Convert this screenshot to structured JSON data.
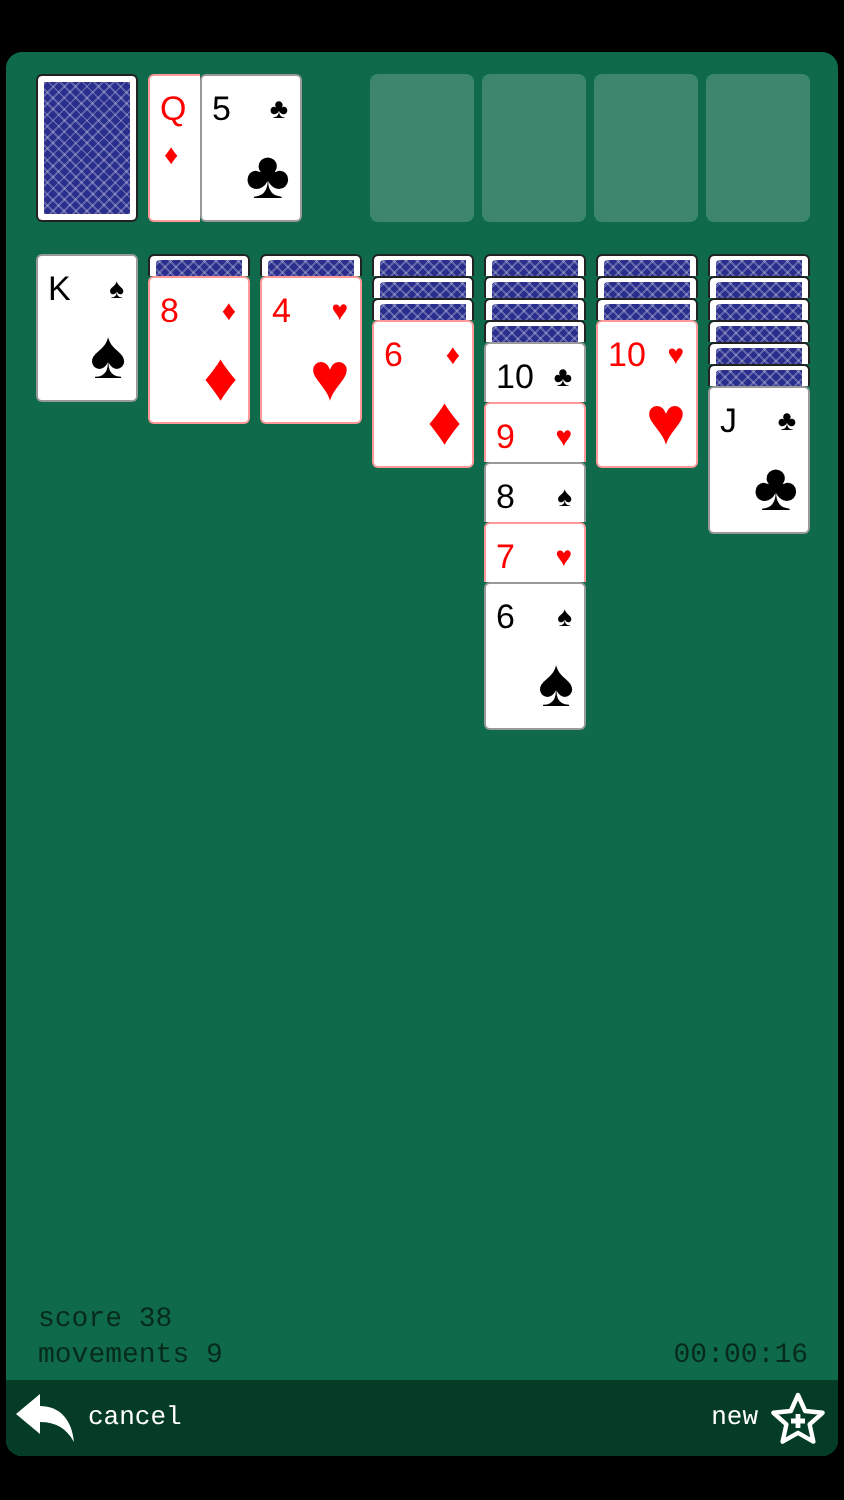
{
  "stock": {
    "face_down": true
  },
  "waste": [
    {
      "rank": "Q",
      "suit": "♦",
      "color": "#ff0000"
    },
    {
      "rank": "5",
      "suit": "♣",
      "pip": "♣",
      "color": "#000000"
    }
  ],
  "foundations": [
    {
      "kind": "empty"
    },
    {
      "kind": "empty"
    },
    {
      "kind": "empty"
    },
    {
      "kind": "empty"
    }
  ],
  "tableau": [
    {
      "cards": [
        {
          "kind": "face",
          "rank": "K",
          "suit": "♠",
          "pip": "♠",
          "color": "#000000"
        }
      ]
    },
    {
      "cards": [
        {
          "kind": "back"
        },
        {
          "kind": "face",
          "rank": "8",
          "suit": "♦",
          "pip": "♦",
          "color": "#ff0000"
        }
      ]
    },
    {
      "cards": [
        {
          "kind": "back"
        },
        {
          "kind": "face",
          "rank": "4",
          "suit": "♥",
          "pip": "♥",
          "color": "#ff0000"
        }
      ]
    },
    {
      "cards": [
        {
          "kind": "back"
        },
        {
          "kind": "back"
        },
        {
          "kind": "back"
        },
        {
          "kind": "face",
          "rank": "6",
          "suit": "♦",
          "pip": "♦",
          "color": "#ff0000"
        }
      ]
    },
    {
      "cards": [
        {
          "kind": "back"
        },
        {
          "kind": "back"
        },
        {
          "kind": "back"
        },
        {
          "kind": "back"
        },
        {
          "kind": "face",
          "rank": "10",
          "suit": "♣",
          "color": "#000000"
        },
        {
          "kind": "face",
          "rank": "9",
          "suit": "♥",
          "color": "#ff0000"
        },
        {
          "kind": "face",
          "rank": "8",
          "suit": "♠",
          "color": "#000000"
        },
        {
          "kind": "face",
          "rank": "7",
          "suit": "♥",
          "color": "#ff0000"
        },
        {
          "kind": "face",
          "rank": "6",
          "suit": "♠",
          "pip": "♠",
          "color": "#000000"
        }
      ]
    },
    {
      "cards": [
        {
          "kind": "back"
        },
        {
          "kind": "back"
        },
        {
          "kind": "back"
        },
        {
          "kind": "face",
          "rank": "10",
          "suit": "♥",
          "pip": "♥",
          "color": "#ff0000"
        }
      ]
    },
    {
      "cards": [
        {
          "kind": "back"
        },
        {
          "kind": "back"
        },
        {
          "kind": "back"
        },
        {
          "kind": "back"
        },
        {
          "kind": "back"
        },
        {
          "kind": "back"
        },
        {
          "kind": "face",
          "rank": "J",
          "suit": "♣",
          "pip": "♣",
          "color": "#000000"
        }
      ]
    }
  ],
  "stats": {
    "score": "score 38",
    "movements": "movements 9",
    "timer": "00:00:16"
  },
  "toolbar": {
    "cancel": "cancel",
    "new": "new"
  }
}
